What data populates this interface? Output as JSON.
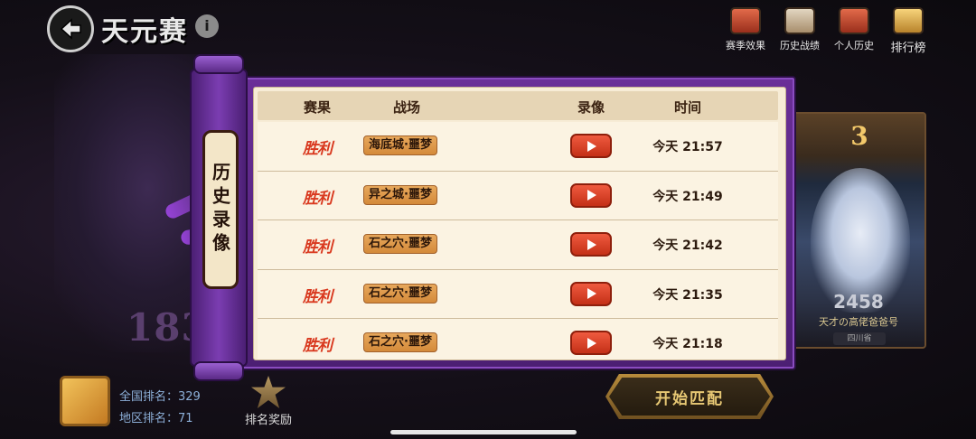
{
  "header": {
    "title": "天元赛",
    "info_icon": "i",
    "menu": [
      {
        "label": "赛季效果",
        "icon": "season-effect-icon"
      },
      {
        "label": "历史战绩",
        "icon": "history-record-icon"
      },
      {
        "label": "个人历史",
        "icon": "personal-history-icon"
      },
      {
        "label": "排行榜",
        "icon": "leaderboard-icon"
      }
    ]
  },
  "background": {
    "rank_number": "183",
    "card": {
      "rank": "3",
      "score": "2458",
      "player_name": "天才の高佬爸爸号",
      "region": "四川省"
    }
  },
  "dialog": {
    "banner_label": "历史录像",
    "headers": {
      "result": "赛果",
      "battlefield": "战场",
      "replay": "录像",
      "time": "时间"
    },
    "rows": [
      {
        "result": "胜利",
        "battlefield": "海底城·噩梦",
        "time": "今天 21:57"
      },
      {
        "result": "胜利",
        "battlefield": "异之城·噩梦",
        "time": "今天 21:49"
      },
      {
        "result": "胜利",
        "battlefield": "石之穴·噩梦",
        "time": "今天 21:42"
      },
      {
        "result": "胜利",
        "battlefield": "石之穴·噩梦",
        "time": "今天 21:35"
      },
      {
        "result": "胜利",
        "battlefield": "石之穴·噩梦",
        "time": "今天 21:18"
      }
    ]
  },
  "footer": {
    "national_rank": "全国排名：329",
    "regional_rank": "地区排名：71",
    "reward_label": "排名奖励",
    "match_button": "开始匹配"
  },
  "colors": {
    "dialog_purple": "#6a2f98",
    "parchment": "#f7ecd6",
    "victory_red": "#d9391f",
    "play_button": "#e1462b",
    "field_badge": "#e39b4e"
  }
}
